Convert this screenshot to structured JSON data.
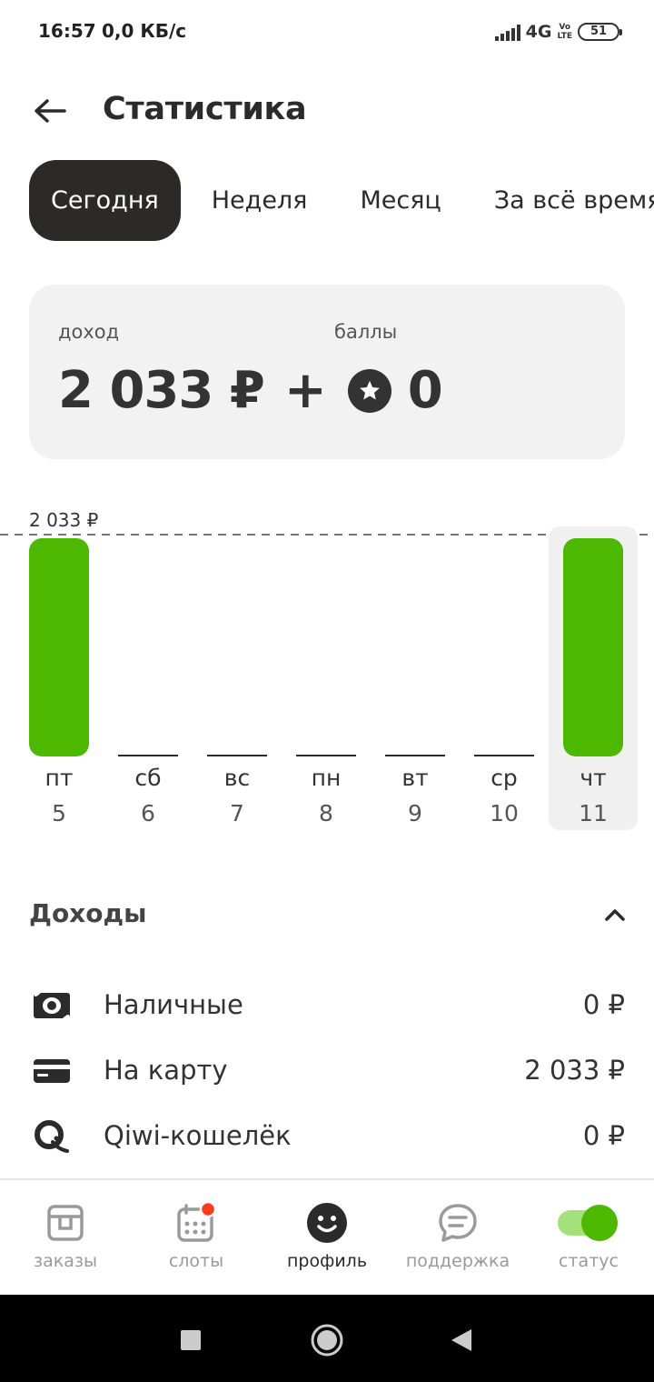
{
  "status_bar": {
    "time": "16:57",
    "speed": "0,0 КБ/с",
    "network": "4G",
    "volte_top": "Vo",
    "volte_bottom": "LTE",
    "battery": "51"
  },
  "header": {
    "back_icon": "arrow-left-icon",
    "title": "Статистика"
  },
  "tabs": [
    {
      "label": "Сегодня",
      "active": true
    },
    {
      "label": "Неделя",
      "active": false
    },
    {
      "label": "Месяц",
      "active": false
    },
    {
      "label": "За всё время",
      "active": false
    }
  ],
  "summary": {
    "income_label": "доход",
    "points_label": "баллы",
    "income_value": "2 033 ₽",
    "plus": "+",
    "points_icon": "star-icon",
    "points_value": "0"
  },
  "chart_data": {
    "type": "bar",
    "max_label": "2 033 ₽",
    "categories": [
      "пт",
      "сб",
      "вс",
      "пн",
      "вт",
      "ср",
      "чт"
    ],
    "dates": [
      "5",
      "6",
      "7",
      "8",
      "9",
      "10",
      "11"
    ],
    "values": [
      2033,
      0,
      0,
      0,
      0,
      0,
      2033
    ],
    "selected_index": 6,
    "ylim": [
      0,
      2033
    ],
    "bar_color": "#4cb800",
    "zero_line_color": "#2b2b2b",
    "selected_bg": "#f0f0f0"
  },
  "incomes": {
    "title": "Доходы",
    "collapse_icon": "chevron-up-icon",
    "items": [
      {
        "label": "Наличные",
        "amount": "0 ₽",
        "icon": "cash-icon"
      },
      {
        "label": "На карту",
        "amount": "2 033 ₽",
        "icon": "card-icon"
      },
      {
        "label": "Qiwi-кошелёк",
        "amount": "0 ₽",
        "icon": "qiwi-icon"
      }
    ]
  },
  "bottom_nav": {
    "items": [
      {
        "label": "заказы",
        "icon": "orders-box-icon",
        "active": false
      },
      {
        "label": "слоты",
        "icon": "calendar-icon",
        "active": false,
        "badge": true
      },
      {
        "label": "профиль",
        "icon": "smiley-icon",
        "active": true
      },
      {
        "label": "поддержка",
        "icon": "chat-bubble-icon",
        "active": false
      },
      {
        "label": "статус",
        "icon": "toggle-icon",
        "active": false,
        "toggle_on": true
      }
    ],
    "accent": "#4cb800",
    "badge_color": "#ff3b1f"
  },
  "android_nav": {
    "recent": "square-icon",
    "home": "circle-icon",
    "back": "triangle-back-icon"
  }
}
